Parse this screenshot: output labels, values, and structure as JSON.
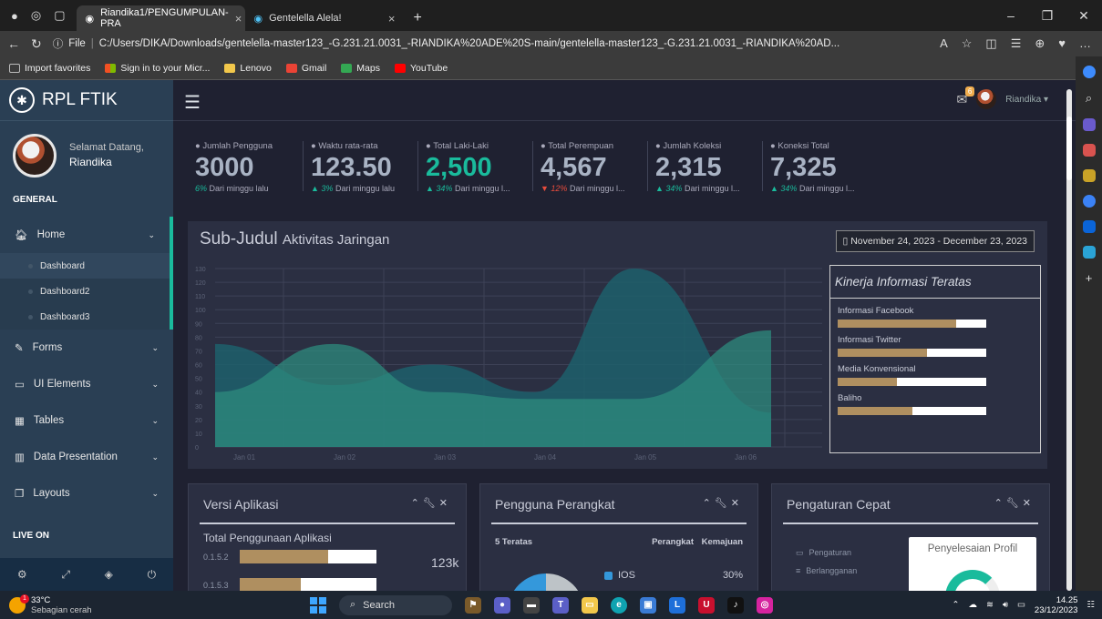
{
  "browser": {
    "tabs": [
      {
        "label": "Riandika1/PENGUMPULAN-PRA"
      },
      {
        "label": "Gentelella Alela!"
      }
    ],
    "url_prefix": "File",
    "url": "C:/Users/DIKA/Downloads/gentelella-master123_-G.231.21.0031_-RIANDIKA%20ADE%20S-main/gentelella-master123_-G.231.21.0031_-RIANDIKA%20AD...",
    "favorites": [
      {
        "label": "Import favorites",
        "color": "#bbbbbb"
      },
      {
        "label": "Sign in to your Micr...",
        "color": "#f25022"
      },
      {
        "label": "Lenovo",
        "color": "#f2c84b"
      },
      {
        "label": "Gmail",
        "color": "#ea4335"
      },
      {
        "label": "Maps",
        "color": "#34a853"
      },
      {
        "label": "YouTube",
        "color": "#ff0000"
      }
    ]
  },
  "sidebar": {
    "brand": "RPL FTIK",
    "welcome": "Selamat Datang,",
    "username": "Riandika",
    "section_general": "GENERAL",
    "home": "Home",
    "sub_items": [
      "Dashboard",
      "Dashboard2",
      "Dashboard3"
    ],
    "items": [
      {
        "label": "Forms",
        "icon": "edit-icon"
      },
      {
        "label": "UI Elements",
        "icon": "desktop-icon"
      },
      {
        "label": "Tables",
        "icon": "table-icon"
      },
      {
        "label": "Data Presentation",
        "icon": "bar-chart-icon"
      },
      {
        "label": "Layouts",
        "icon": "clone-icon"
      }
    ],
    "section_live": "LIVE ON"
  },
  "topnav": {
    "mail_count": "6",
    "user": "Riandika"
  },
  "tiles": [
    {
      "label": "Jumlah Pengguna",
      "value": "3000",
      "sub_pct": "6%",
      "sub_text": " Dari minggu lalu",
      "trend": "none",
      "green": false
    },
    {
      "label": "Waktu rata-rata",
      "value": "123.50",
      "sub_pct": "3%",
      "sub_text": " Dari minggu lalu",
      "trend": "up",
      "green": false
    },
    {
      "label": "Total Laki-Laki",
      "value": "2,500",
      "sub_pct": "34%",
      "sub_text": " Dari minggu l...",
      "trend": "up",
      "green": true
    },
    {
      "label": "Total Perempuan",
      "value": "4,567",
      "sub_pct": "12%",
      "sub_text": " Dari minggu l...",
      "trend": "down",
      "green": false
    },
    {
      "label": "Jumlah Koleksi",
      "value": "2,315",
      "sub_pct": "34%",
      "sub_text": " Dari minggu l...",
      "trend": "up",
      "green": false
    },
    {
      "label": "Koneksi Total",
      "value": "7,325",
      "sub_pct": "34%",
      "sub_text": " Dari minggu l...",
      "trend": "up",
      "green": false
    }
  ],
  "network": {
    "title": "Sub-Judul",
    "title_small": "Aktivitas Jaringan",
    "date_range": "November 24, 2023 - December 23, 2023"
  },
  "chart_data": {
    "type": "area",
    "x": [
      "Jan 01",
      "Jan 02",
      "Jan 03",
      "Jan 04",
      "Jan 05",
      "Jan 06"
    ],
    "ylim": [
      0,
      130
    ],
    "yticks": [
      0,
      10,
      20,
      30,
      40,
      50,
      60,
      70,
      80,
      90,
      100,
      110,
      120,
      130
    ],
    "series": [
      {
        "values": [
          75,
          45,
          60,
          40,
          130,
          25
        ],
        "color": "#1d5f6b"
      },
      {
        "values": [
          40,
          75,
          40,
          35,
          35,
          85
        ],
        "color": "#2e8b7d"
      }
    ]
  },
  "kinerja": {
    "title": "Kinerja Informasi Teratas",
    "items": [
      {
        "label": "Informasi Facebook",
        "fraction": 0.8
      },
      {
        "label": "Informasi Twitter",
        "fraction": 0.6
      },
      {
        "label": "Media Konvensional",
        "fraction": 0.4
      },
      {
        "label": "Baliho",
        "fraction": 0.5
      }
    ]
  },
  "panel_versi": {
    "title": "Versi Aplikasi",
    "subtitle": "Total Penggunaan Aplikasi",
    "rows": [
      {
        "label": "0.1.5.2",
        "fraction": 0.65
      },
      {
        "label": "0.1.5.3",
        "fraction": 0.45
      }
    ],
    "value": "123k"
  },
  "panel_perangkat": {
    "title": "Pengguna Perangkat",
    "heads": [
      "5 Teratas",
      "Perangkat",
      "Kemajuan"
    ],
    "device": "IOS",
    "device_value": "30%"
  },
  "panel_cepat": {
    "title": "Pengaturan Cepat",
    "items": [
      "Pengaturan",
      "Berlangganan"
    ],
    "profile_card": "Penyelesaian Profil"
  },
  "taskbar": {
    "temp": "33°C",
    "weather": "Sebagian cerah",
    "search": "Search",
    "time": "14.25",
    "date": "23/12/2023"
  }
}
